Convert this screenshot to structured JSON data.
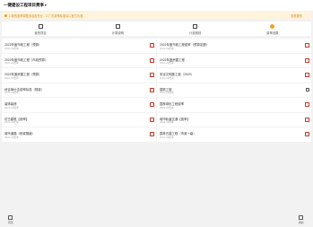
{
  "header": {
    "title": "一键建设工程项目费率",
    "caret": "▾"
  },
  "notice": {
    "message": "1.我的费率调整涉及各专业... 2.广东费率标准请以官方为准...",
    "link": "查看更多"
  },
  "tabs": [
    {
      "label": "我的项目",
      "icon": "document-icon"
    },
    {
      "label": "计算说明",
      "icon": "calculator-icon"
    },
    {
      "label": "计费规则",
      "icon": "chart-icon"
    },
    {
      "label": "费率设置",
      "icon": "coin-icon"
    }
  ],
  "cards": [
    [
      {
        "name": "2022年度市政工程（预算）",
        "sub": "2021-22费率",
        "action": "red"
      },
      {
        "name": "2022年度市政工程费率（预算定额）",
        "sub": "2021-22费率",
        "action": "red"
      }
    ],
    [
      {
        "name": "2022年度市政工程（市政预算）",
        "sub": "2021-22费率",
        "action": "red"
      },
      {
        "name": "2022年度房建工程",
        "sub": "2021-22费率",
        "action": "red"
      }
    ],
    [
      {
        "name": "2022年度房建工程（预算）",
        "sub": "2021-22费率",
        "action": "red"
      },
      {
        "name": "安全文明施工费（2020）",
        "sub": "2021-22费率",
        "action": "red"
      }
    ],
    [
      {
        "name": "综合单价法费率标准（规费）",
        "sub": "2021-22费率",
        "action": "red"
      },
      {
        "name": "建筑工程",
        "sub": "2021-22费率",
        "action": "dark"
      }
    ],
    [
      {
        "name": "装饰装修",
        "sub": "2021-22费率",
        "action": "red"
      },
      {
        "name": "园林绿化工程费率",
        "sub": "2021-22费率",
        "action": "red"
      }
    ],
    [
      {
        "name": "仿古建筑【费率】",
        "sub": "2021-22费率",
        "action": "red"
      },
      {
        "name": "城市轨道交通【费率】",
        "sub": "2021-22费率",
        "action": "red"
      }
    ],
    [
      {
        "name": "城市道路（桥梁隧道）",
        "sub": "2021-22费率",
        "action": "red"
      },
      {
        "name": "园林古建工程（市政一级）",
        "sub": "2021-22费率",
        "action": "red"
      }
    ]
  ],
  "bottom_nav": [
    {
      "label": "首页",
      "icon": "home-icon"
    },
    {
      "label": "我的",
      "icon": "user-icon"
    }
  ]
}
